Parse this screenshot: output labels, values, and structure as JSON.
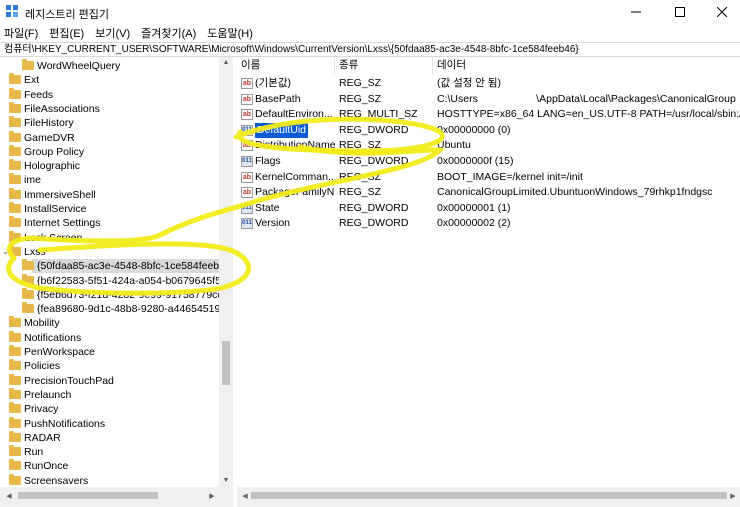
{
  "window": {
    "title": "레지스트리 편집기"
  },
  "menu": [
    "파일(F)",
    "편집(E)",
    "보기(V)",
    "즐겨찾기(A)",
    "도움말(H)"
  ],
  "address": "컴퓨터\\HKEY_CURRENT_USER\\SOFTWARE\\Microsoft\\Windows\\CurrentVersion\\Lxss\\{50fdaa85-ac3e-4548-8bfc-1ce584feeb46}",
  "tree": [
    {
      "label": "WordWheelQuery",
      "indent": 1
    },
    {
      "label": "Ext",
      "indent": 0
    },
    {
      "label": "Feeds",
      "indent": 0
    },
    {
      "label": "FileAssociations",
      "indent": 0
    },
    {
      "label": "FileHistory",
      "indent": 0
    },
    {
      "label": "GameDVR",
      "indent": 0
    },
    {
      "label": "Group Policy",
      "indent": 0
    },
    {
      "label": "Holographic",
      "indent": 0
    },
    {
      "label": "ime",
      "indent": 0
    },
    {
      "label": "ImmersiveShell",
      "indent": 0
    },
    {
      "label": "InstallService",
      "indent": 0
    },
    {
      "label": "Internet Settings",
      "indent": 0
    },
    {
      "label": "Lock Screen",
      "indent": 0
    },
    {
      "label": "Lxss",
      "indent": 0,
      "expanded": true
    },
    {
      "label": "{50fdaa85-ac3e-4548-8bfc-1ce584feeb46}",
      "indent": 1,
      "selected": true
    },
    {
      "label": "{b6f22583-5f51-424a-a054-b0679645f59b",
      "indent": 1
    },
    {
      "label": "{f5eb6d73-f21d-4282-9e99-91758779ccfb",
      "indent": 1
    },
    {
      "label": "{fea89680-9d1c-48b8-9280-a44654519c56",
      "indent": 1
    },
    {
      "label": "Mobility",
      "indent": 0
    },
    {
      "label": "Notifications",
      "indent": 0
    },
    {
      "label": "PenWorkspace",
      "indent": 0
    },
    {
      "label": "Policies",
      "indent": 0
    },
    {
      "label": "PrecisionTouchPad",
      "indent": 0
    },
    {
      "label": "Prelaunch",
      "indent": 0
    },
    {
      "label": "Privacy",
      "indent": 0
    },
    {
      "label": "PushNotifications",
      "indent": 0
    },
    {
      "label": "RADAR",
      "indent": 0
    },
    {
      "label": "Run",
      "indent": 0
    },
    {
      "label": "RunOnce",
      "indent": 0
    },
    {
      "label": "Screensavers",
      "indent": 0
    }
  ],
  "columns": {
    "name": "이름",
    "type": "종류",
    "data": "데이터"
  },
  "values": [
    {
      "icon": "ab",
      "name": "(기본값)",
      "type": "REG_SZ",
      "data": "(값 설정 안 됨)"
    },
    {
      "icon": "ab",
      "name": "BasePath",
      "type": "REG_SZ",
      "data": "C:\\Users                    \\AppData\\Local\\Packages\\CanonicalGroup"
    },
    {
      "icon": "ab",
      "name": "DefaultEnviron...",
      "type": "REG_MULTI_SZ",
      "data": "HOSTTYPE=x86_64 LANG=en_US.UTF-8 PATH=/usr/local/sbin:/usr/lo"
    },
    {
      "icon": "num",
      "name": "DefaultUid",
      "type": "REG_DWORD",
      "data": "0x00000000 (0)",
      "selected": true
    },
    {
      "icon": "ab",
      "name": "DistributionName",
      "type": "REG_SZ",
      "data": "Ubuntu"
    },
    {
      "icon": "num",
      "name": "Flags",
      "type": "REG_DWORD",
      "data": "0x0000000f (15)"
    },
    {
      "icon": "ab",
      "name": "KernelComman...",
      "type": "REG_SZ",
      "data": "BOOT_IMAGE=/kernel init=/init"
    },
    {
      "icon": "ab",
      "name": "PackageFamilyN...",
      "type": "REG_SZ",
      "data": "CanonicalGroupLimited.UbuntuonWindows_79rhkp1fndgsc"
    },
    {
      "icon": "num",
      "name": "State",
      "type": "REG_DWORD",
      "data": "0x00000001 (1)"
    },
    {
      "icon": "num",
      "name": "Version",
      "type": "REG_DWORD",
      "data": "0x00000002 (2)"
    }
  ],
  "colors": {
    "selection": "#0a5bd6",
    "tree_selection": "#d9d9d9",
    "folder": "#e8b84a",
    "annotation": "#f2ec1a"
  },
  "icons": {
    "app": "registry-icon",
    "folder": "folder-icon",
    "string_value": "ab-string-icon",
    "dword_value": "binary-dword-icon"
  }
}
